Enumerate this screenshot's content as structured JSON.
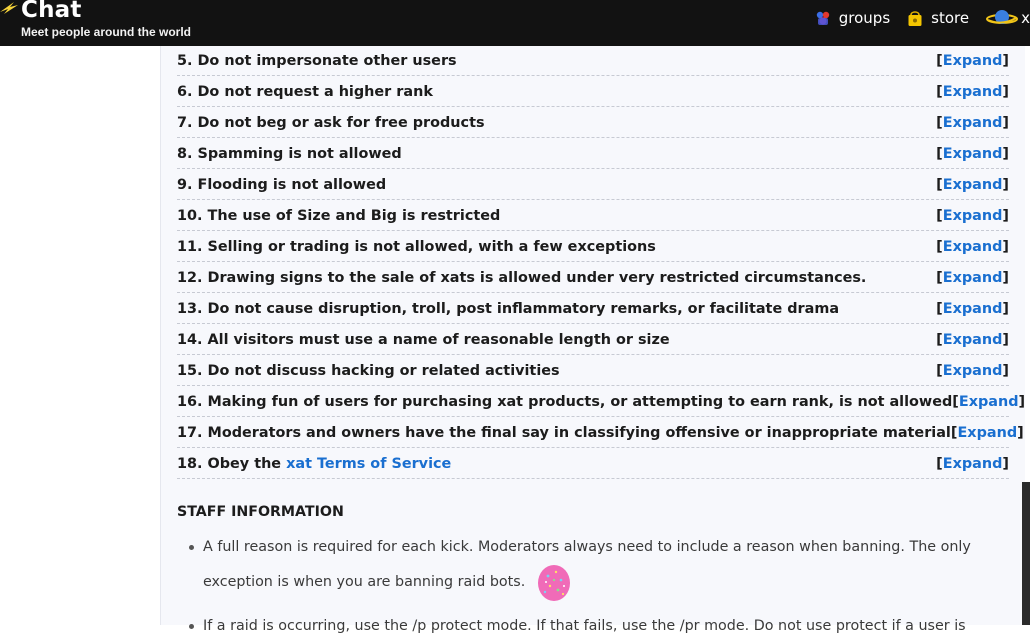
{
  "header": {
    "title": "Chat",
    "tagline": "Meet people around the world",
    "nav": [
      {
        "label": "groups",
        "icon": "groups-icon"
      },
      {
        "label": "store",
        "icon": "store-bag-icon"
      },
      {
        "label": "x",
        "icon": "planet-icon"
      }
    ]
  },
  "rules": {
    "expand_open": "[",
    "expand_label": "Expand",
    "expand_close": "]",
    "items": [
      {
        "text": "5. Do not impersonate other users"
      },
      {
        "text": "6. Do not request a higher rank"
      },
      {
        "text": "7. Do not beg or ask for free products"
      },
      {
        "text": "8. Spamming is not allowed"
      },
      {
        "text": "9. Flooding is not allowed"
      },
      {
        "text": "10. The use of Size and Big is restricted"
      },
      {
        "text": "11. Selling or trading is not allowed, with a few exceptions"
      },
      {
        "text": "12. Drawing signs to the sale of xats is allowed under very restricted circumstances."
      },
      {
        "text": "13. Do not cause disruption, troll, post inflammatory remarks, or facilitate drama"
      },
      {
        "text": "14. All visitors must use a name of reasonable length or size"
      },
      {
        "text": "15. Do not discuss hacking or related activities"
      },
      {
        "text": "16. Making fun of users for purchasing xat products, or attempting to earn rank, is not allowed"
      },
      {
        "text": "17. Moderators and owners have the final say in classifying offensive or inappropriate material"
      },
      {
        "text": "18. Obey the ",
        "link": "xat Terms of Service"
      }
    ]
  },
  "staff": {
    "title": "STAFF INFORMATION",
    "bullets": [
      "A full reason is required for each kick. Moderators always need to include a reason when banning. The only exception is when you are banning raid bots.",
      "If a raid is occurring, use the /p protect mode. If that fails, use the /pr mode. Do not use protect if a user is"
    ]
  },
  "colors": {
    "link": "#1a6fd0",
    "topbar": "#121212",
    "panel": "#f7f8fc"
  }
}
